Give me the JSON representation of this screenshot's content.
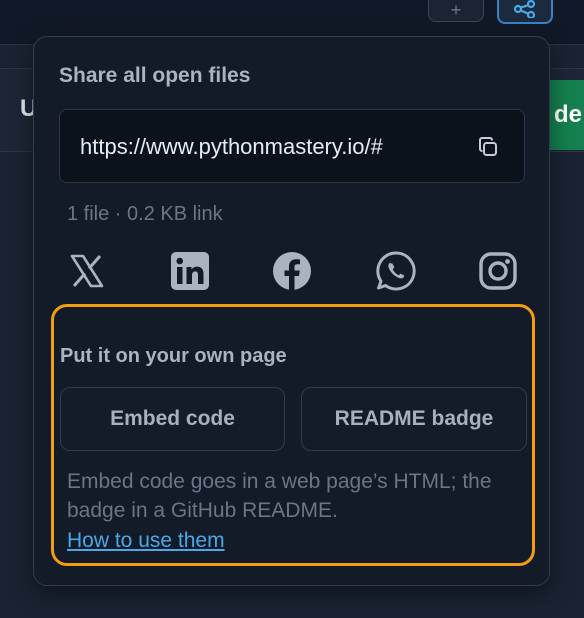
{
  "toolbar": {
    "plus_icon": "plus-icon",
    "share_icon": "share-icon",
    "left_partial_text": "U",
    "right_partial_button": "de"
  },
  "share_panel": {
    "title": "Share all open files",
    "url": "https://www.pythonmastery.io/#",
    "copy_icon": "copy-icon",
    "file_info": "1 file · 0.2 KB link",
    "social_icons": [
      "x-icon",
      "linkedin-icon",
      "facebook-icon",
      "whatsapp-icon",
      "instagram-icon"
    ]
  },
  "embed_section": {
    "title": "Put it on your own page",
    "embed_button": "Embed code",
    "readme_button": "README badge",
    "description": "Embed code goes in a web page’s HTML; the badge in a GitHub README.",
    "help_link": "How to use them"
  },
  "colors": {
    "panel_bg": "#131b29",
    "highlight": "#f29d13",
    "link": "#4aa8e8",
    "accent_green": "#15804f",
    "accent_blue": "#3b82c4"
  }
}
